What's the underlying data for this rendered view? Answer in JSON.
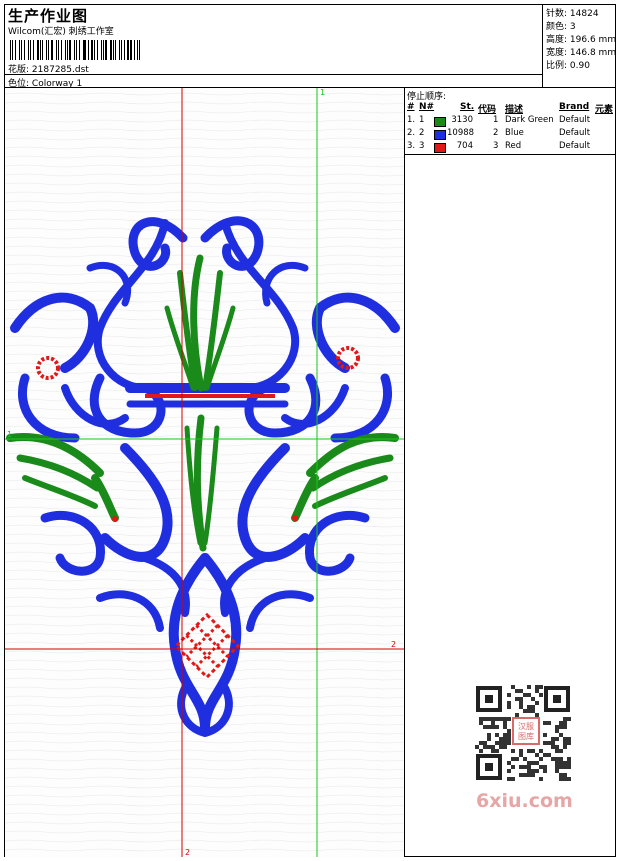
{
  "header": {
    "title": "生产作业图",
    "subtitle": "Wilcom(汇宏) 刺绣工作室",
    "fabric_label": "花版:",
    "fabric_value": "2187285.dst",
    "color_label": "色位:",
    "color_value": "Colorway 1"
  },
  "stats": {
    "stitches_label": "针数:",
    "stitches_value": "14824",
    "colors_label": "颜色:",
    "colors_value": "3",
    "height_label": "高度:",
    "height_value": "196.6 mm",
    "width_label": "宽度:",
    "width_value": "146.8 mm",
    "scale_label": "比例:",
    "scale_value": "0.90"
  },
  "stop_sequence": {
    "title": "停止顺序:",
    "columns": [
      "#",
      "N#",
      "St.",
      "代码",
      "描述",
      "Brand",
      "元素"
    ],
    "rows": [
      {
        "index": "1.",
        "n": "1",
        "color": "#1a8a1a",
        "stitches": "3130",
        "code": "1",
        "desc": "Dark Green",
        "brand": "Default"
      },
      {
        "index": "2.",
        "n": "2",
        "color": "#1f2fe0",
        "stitches": "10988",
        "code": "2",
        "desc": "Blue",
        "brand": "Default"
      },
      {
        "index": "3.",
        "n": "3",
        "color": "#e01818",
        "stitches": "704",
        "code": "3",
        "desc": "Red",
        "brand": "Default"
      }
    ]
  },
  "guides": {
    "v1_label": "1",
    "v2_label": "2",
    "h1_label": "1",
    "h2_label": "2"
  },
  "colors": {
    "blue": "#1f2fe0",
    "green": "#1a8a1a",
    "red": "#e01818",
    "guide_red": "#d40000",
    "guide_green": "#18c818"
  },
  "watermark": "6xiu.com",
  "qr_stamp": "汉服图库"
}
